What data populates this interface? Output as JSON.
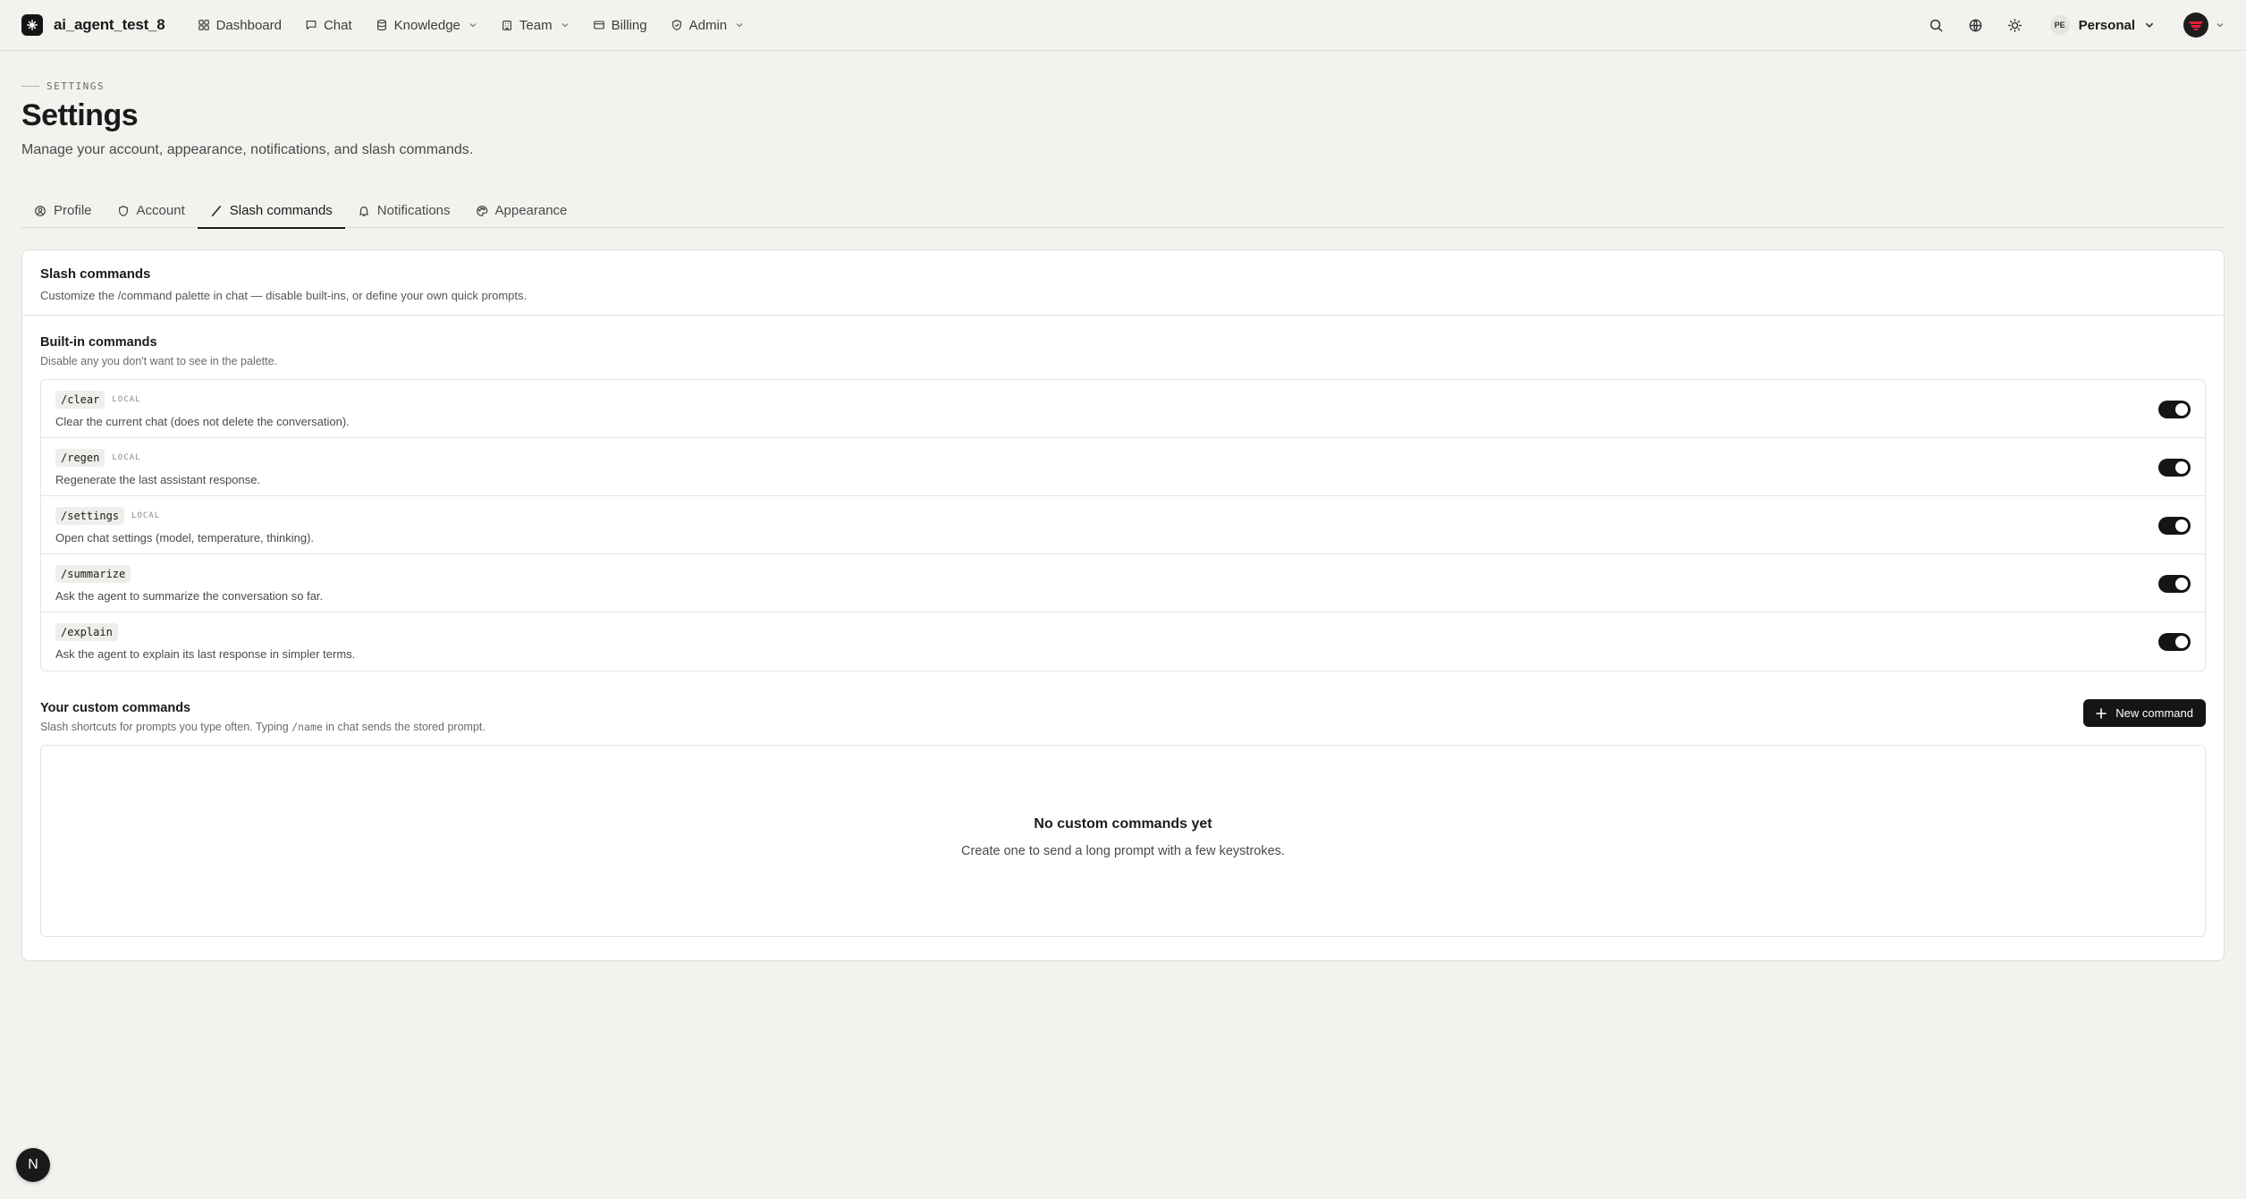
{
  "app": {
    "name": "ai_agent_test_8"
  },
  "nav": {
    "items": [
      {
        "label": "Dashboard",
        "icon": "dashboard-icon"
      },
      {
        "label": "Chat",
        "icon": "chat-icon"
      },
      {
        "label": "Knowledge",
        "icon": "knowledge-icon",
        "dropdown": true
      },
      {
        "label": "Team",
        "icon": "team-icon",
        "dropdown": true
      },
      {
        "label": "Billing",
        "icon": "billing-icon"
      },
      {
        "label": "Admin",
        "icon": "admin-icon",
        "dropdown": true
      }
    ]
  },
  "workspace": {
    "initials": "PE",
    "label": "Personal"
  },
  "header": {
    "eyebrow": "SETTINGS",
    "title": "Settings",
    "subtitle": "Manage your account, appearance, notifications, and slash commands."
  },
  "tabs": [
    {
      "label": "Profile",
      "icon": "profile-icon",
      "active": false
    },
    {
      "label": "Account",
      "icon": "shield-icon",
      "active": false
    },
    {
      "label": "Slash commands",
      "icon": "slash-icon",
      "active": true
    },
    {
      "label": "Notifications",
      "icon": "bell-icon",
      "active": false
    },
    {
      "label": "Appearance",
      "icon": "palette-icon",
      "active": false
    }
  ],
  "slash": {
    "title": "Slash commands",
    "description": "Customize the /command palette in chat — disable built-ins, or define your own quick prompts."
  },
  "builtin": {
    "title": "Built-in commands",
    "description": "Disable any you don't want to see in the palette.",
    "commands": [
      {
        "name": "/clear",
        "tag": "LOCAL",
        "description": "Clear the current chat (does not delete the conversation).",
        "enabled": true
      },
      {
        "name": "/regen",
        "tag": "LOCAL",
        "description": "Regenerate the last assistant response.",
        "enabled": true
      },
      {
        "name": "/settings",
        "tag": "LOCAL",
        "description": "Open chat settings (model, temperature, thinking).",
        "enabled": true
      },
      {
        "name": "/summarize",
        "tag": "",
        "description": "Ask the agent to summarize the conversation so far.",
        "enabled": true
      },
      {
        "name": "/explain",
        "tag": "",
        "description": "Ask the agent to explain its last response in simpler terms.",
        "enabled": true
      }
    ]
  },
  "custom": {
    "title": "Your custom commands",
    "description_prefix": "Slash shortcuts for prompts you type often. Typing ",
    "description_code": "/name",
    "description_suffix": " in chat sends the stored prompt.",
    "new_button": "New command",
    "empty_title": "No custom commands yet",
    "empty_desc": "Create one to send a long prompt with a few keystrokes."
  },
  "fab": {
    "label": "N"
  },
  "colors": {
    "background": "#f3f2ef",
    "card": "#ffffff",
    "accent": "#151515",
    "border": "#dedcd7"
  }
}
